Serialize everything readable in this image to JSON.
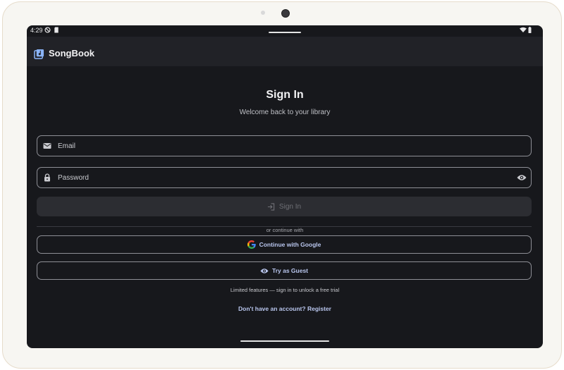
{
  "status_bar": {
    "time": "4:29",
    "icons_left": [
      "do-not-disturb-icon",
      "sd-card-icon"
    ],
    "icons_right": [
      "wifi-icon",
      "battery-icon"
    ]
  },
  "app_bar": {
    "title": "SongBook",
    "logo_icon": "music-library-icon"
  },
  "signin_page": {
    "title": "Sign In",
    "subtitle": "Welcome back to your library",
    "email": {
      "placeholder": "Email",
      "value": "",
      "icon": "mail-icon"
    },
    "password": {
      "placeholder": "Password",
      "value": "",
      "icon": "lock-icon",
      "toggle_icon": "eye-icon"
    },
    "signin_button": {
      "label": "Sign In",
      "icon": "login-icon",
      "enabled": false
    },
    "divider_text": "or continue with",
    "google_button": {
      "label": "Continue with Google",
      "icon": "google-icon"
    },
    "guest_button": {
      "label": "Try as Guest",
      "icon": "eye-icon"
    },
    "guest_note": "Limited features — sign in to unlock a free trial",
    "register_prompt": "Don't have an account?",
    "register_link": "Register"
  },
  "colors": {
    "background": "#17181c",
    "app_bar": "#212227",
    "accent_text": "#b9c6ee",
    "outline": "#8e8f96",
    "disabled_button": "#2c2d32"
  }
}
